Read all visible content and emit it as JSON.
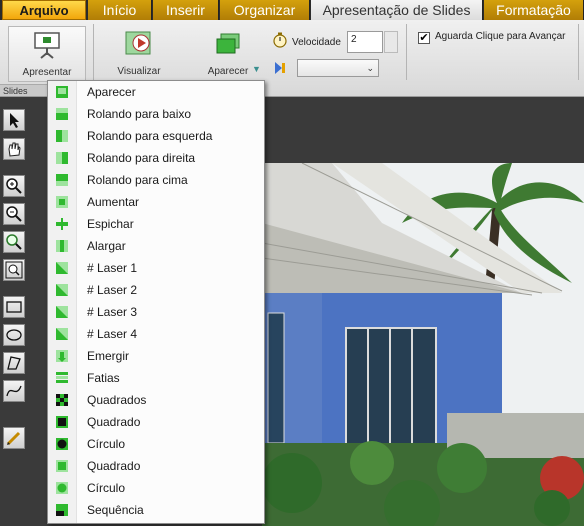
{
  "tabs": [
    {
      "label": "Arquivo",
      "style": "file"
    },
    {
      "label": "Início",
      "style": "gold"
    },
    {
      "label": "Inserir",
      "style": "gold"
    },
    {
      "label": "Organizar",
      "style": "gold"
    },
    {
      "label": "Apresentação de Slides",
      "style": "active"
    },
    {
      "label": "Formatação",
      "style": "gold"
    }
  ],
  "ribbon": {
    "present_label": "Apresentar",
    "preview_label": "Visualizar",
    "transition_label": "Aparecer",
    "speed_label": "Velocidade",
    "speed_value": "2",
    "wait_click_label": "Aguarda Clique para Avançar",
    "wait_click_checked": true,
    "group_label": "Slides"
  },
  "transition_menu": [
    {
      "label": "Aparecer",
      "icon": "appear-icon"
    },
    {
      "label": "Rolando para baixo",
      "icon": "roll-down-icon"
    },
    {
      "label": "Rolando para esquerda",
      "icon": "roll-left-icon"
    },
    {
      "label": "Rolando para direita",
      "icon": "roll-right-icon"
    },
    {
      "label": "Rolando para cima",
      "icon": "roll-up-icon"
    },
    {
      "label": "Aumentar",
      "icon": "grow-icon"
    },
    {
      "label": "Espichar",
      "icon": "stretch-icon"
    },
    {
      "label": "Alargar",
      "icon": "widen-icon"
    },
    {
      "label": "# Laser 1",
      "icon": "laser-icon"
    },
    {
      "label": "# Laser 2",
      "icon": "laser-icon"
    },
    {
      "label": "# Laser 3",
      "icon": "laser-icon"
    },
    {
      "label": "# Laser 4",
      "icon": "laser-icon"
    },
    {
      "label": "Emergir",
      "icon": "emerge-icon"
    },
    {
      "label": "Fatias",
      "icon": "slices-icon"
    },
    {
      "label": "Quadrados",
      "icon": "checker-icon"
    },
    {
      "label": "Quadrado",
      "icon": "square-black-icon"
    },
    {
      "label": "Círculo",
      "icon": "circle-black-icon"
    },
    {
      "label": "Quadrado",
      "icon": "square-green-icon"
    },
    {
      "label": "Círculo",
      "icon": "circle-green-icon"
    },
    {
      "label": "Sequência",
      "icon": "sequence-icon"
    }
  ],
  "tools": [
    "pointer-icon",
    "hand-icon",
    "zoom-in-icon",
    "zoom-out-icon",
    "zoom-search-icon",
    "zoom-fit-icon",
    "rectangle-icon",
    "ellipse-icon",
    "polygon-icon",
    "curve-icon",
    "pen-icon"
  ],
  "colors": {
    "file_tab": "#f2a60b",
    "tab_gold": "#c6900a",
    "menu_icon_green": "#2fb92f",
    "dark_bg": "#3a3a3a"
  }
}
